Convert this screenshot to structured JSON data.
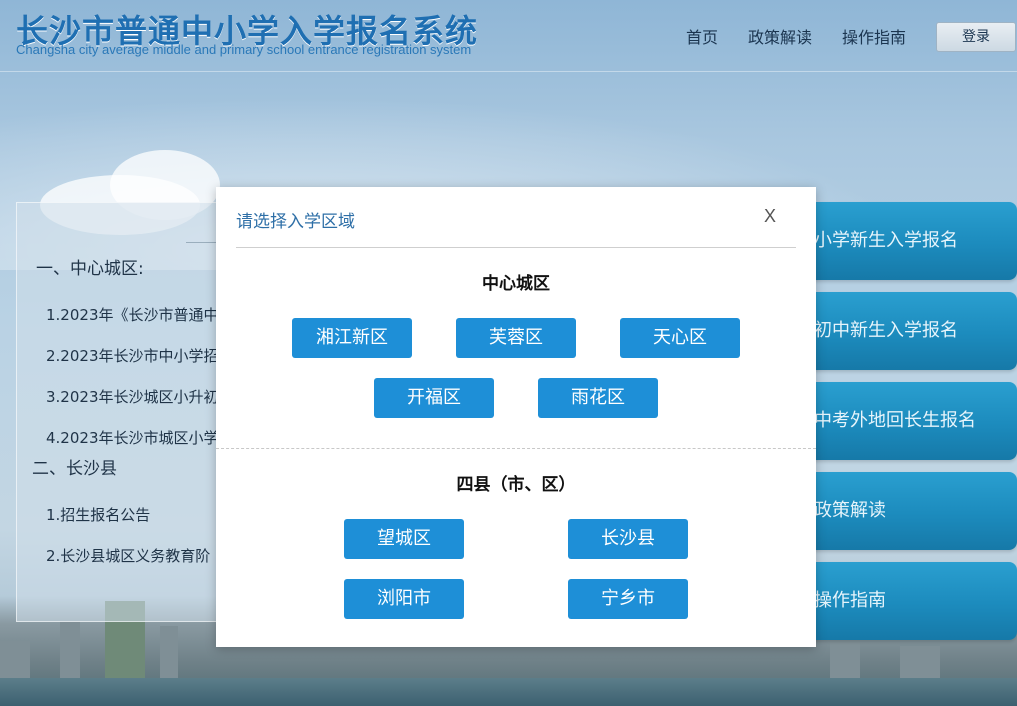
{
  "header": {
    "title": "长沙市普通中小学入学报名系统",
    "subtitle": "Changsha city average middle and primary school entrance registration system",
    "nav": {
      "home": "首页",
      "policy": "政策解读",
      "guide": "操作指南"
    },
    "login_label": "登录"
  },
  "left_panel": {
    "section1": "一、中心城区:",
    "items1": [
      "1.2023年《长沙市普通中",
      "2.2023年长沙市中小学招",
      "3.2023年长沙城区小升初",
      "4.2023年长沙市城区小学"
    ],
    "section2": "二、长沙县",
    "items2": [
      "1.招生报名公告",
      "2.长沙县城区义务教育阶"
    ]
  },
  "right_cards": [
    "小学新生入学报名",
    "初中新生入学报名",
    "中考外地回长生报名",
    "政策解读",
    "操作指南"
  ],
  "modal": {
    "title": "请选择入学区域",
    "close": "X",
    "group1": {
      "title": "中心城区",
      "districts": [
        "湘江新区",
        "芙蓉区",
        "天心区",
        "开福区",
        "雨花区"
      ]
    },
    "group2": {
      "title": "四县（市、区）",
      "districts": [
        "望城区",
        "长沙县",
        "浏阳市",
        "宁乡市"
      ]
    }
  },
  "colors": {
    "primary_button": "#1e8fd7",
    "card_blue": "#1c8bbd",
    "title_blue": "#1f6fb2"
  }
}
